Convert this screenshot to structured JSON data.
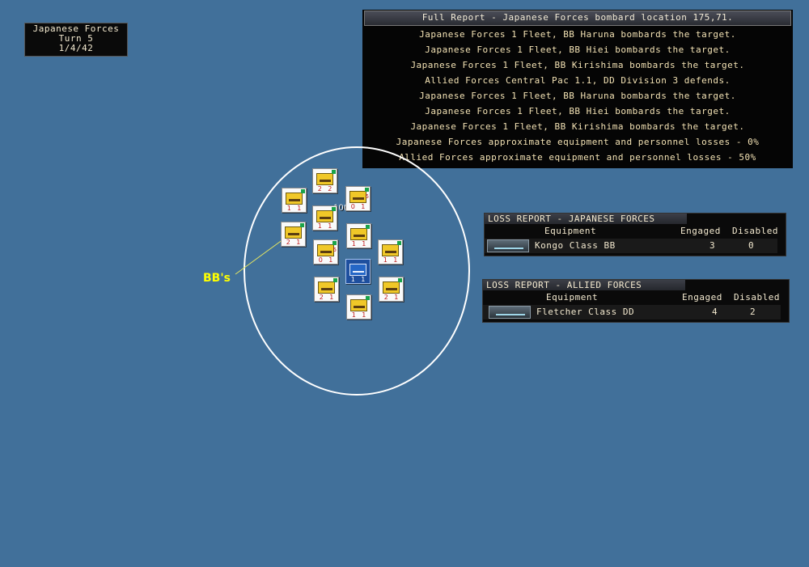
{
  "turn_box": {
    "side": "Japanese Forces",
    "turn": "Turn 5",
    "date": "1/4/42"
  },
  "full_report": {
    "title": "Full Report -  Japanese Forces bombard location 175,71.",
    "lines": [
      "Japanese Forces 1 Fleet, BB Haruna bombards the target.",
      "Japanese Forces 1 Fleet, BB Hiei bombards the target.",
      "Japanese Forces 1 Fleet, BB Kirishima bombards the target.",
      "Allied Forces Central Pac 1.1, DD Division 3 defends.",
      "Japanese Forces 1 Fleet, BB Haruna bombards the target.",
      "Japanese Forces 1 Fleet, BB Hiei bombards the target.",
      "Japanese Forces 1 Fleet, BB Kirishima bombards the target.",
      "Japanese Forces approximate equipment and personnel losses - 0%",
      "Allied Forces approximate equipment and personnel losses - 50%"
    ]
  },
  "loss_japanese": {
    "title": "LOSS REPORT -  JAPANESE FORCES",
    "col_equipment": "Equipment",
    "col_engaged": "Engaged",
    "col_disabled": "Disabled",
    "row": {
      "name": "Kongo Class BB",
      "engaged": "3",
      "disabled": "0",
      "icon": "ship-icon"
    }
  },
  "loss_allied": {
    "title": "LOSS REPORT -  ALLIED FORCES",
    "col_equipment": "Equipment",
    "col_engaged": "Engaged",
    "col_disabled": "Disabled",
    "row": {
      "name": "Fletcher Class DD",
      "engaged": "4",
      "disabled": "2",
      "icon": "ship-icon"
    }
  },
  "map": {
    "base_label": "100  and",
    "annotation": "BB's",
    "counters": [
      {
        "side": "japanese",
        "n1": "2",
        "n2": "2"
      },
      {
        "side": "japanese",
        "n1": "1",
        "n2": "1"
      },
      {
        "side": "japanese",
        "n1": "0",
        "n2": "1",
        "flag_num": "5"
      },
      {
        "side": "japanese",
        "n1": "1",
        "n2": "1"
      },
      {
        "side": "japanese",
        "n1": "2",
        "n2": "1"
      },
      {
        "side": "japanese",
        "n1": "1",
        "n2": "1"
      },
      {
        "side": "japanese",
        "n1": "0",
        "n2": "1",
        "flag_num": "5"
      },
      {
        "side": "japanese",
        "n1": "1",
        "n2": "1"
      },
      {
        "side": "allied",
        "n1": "1",
        "n2": "1"
      },
      {
        "side": "japanese",
        "n1": "2",
        "n2": "1"
      },
      {
        "side": "japanese",
        "n1": "2",
        "n2": "1"
      },
      {
        "side": "japanese",
        "n1": "1",
        "n2": "1"
      }
    ]
  },
  "colors": {
    "ocean": "#41709a",
    "report_text": "#f3e2b4",
    "annotation": "#ffff00",
    "circle": "#ffffff"
  }
}
